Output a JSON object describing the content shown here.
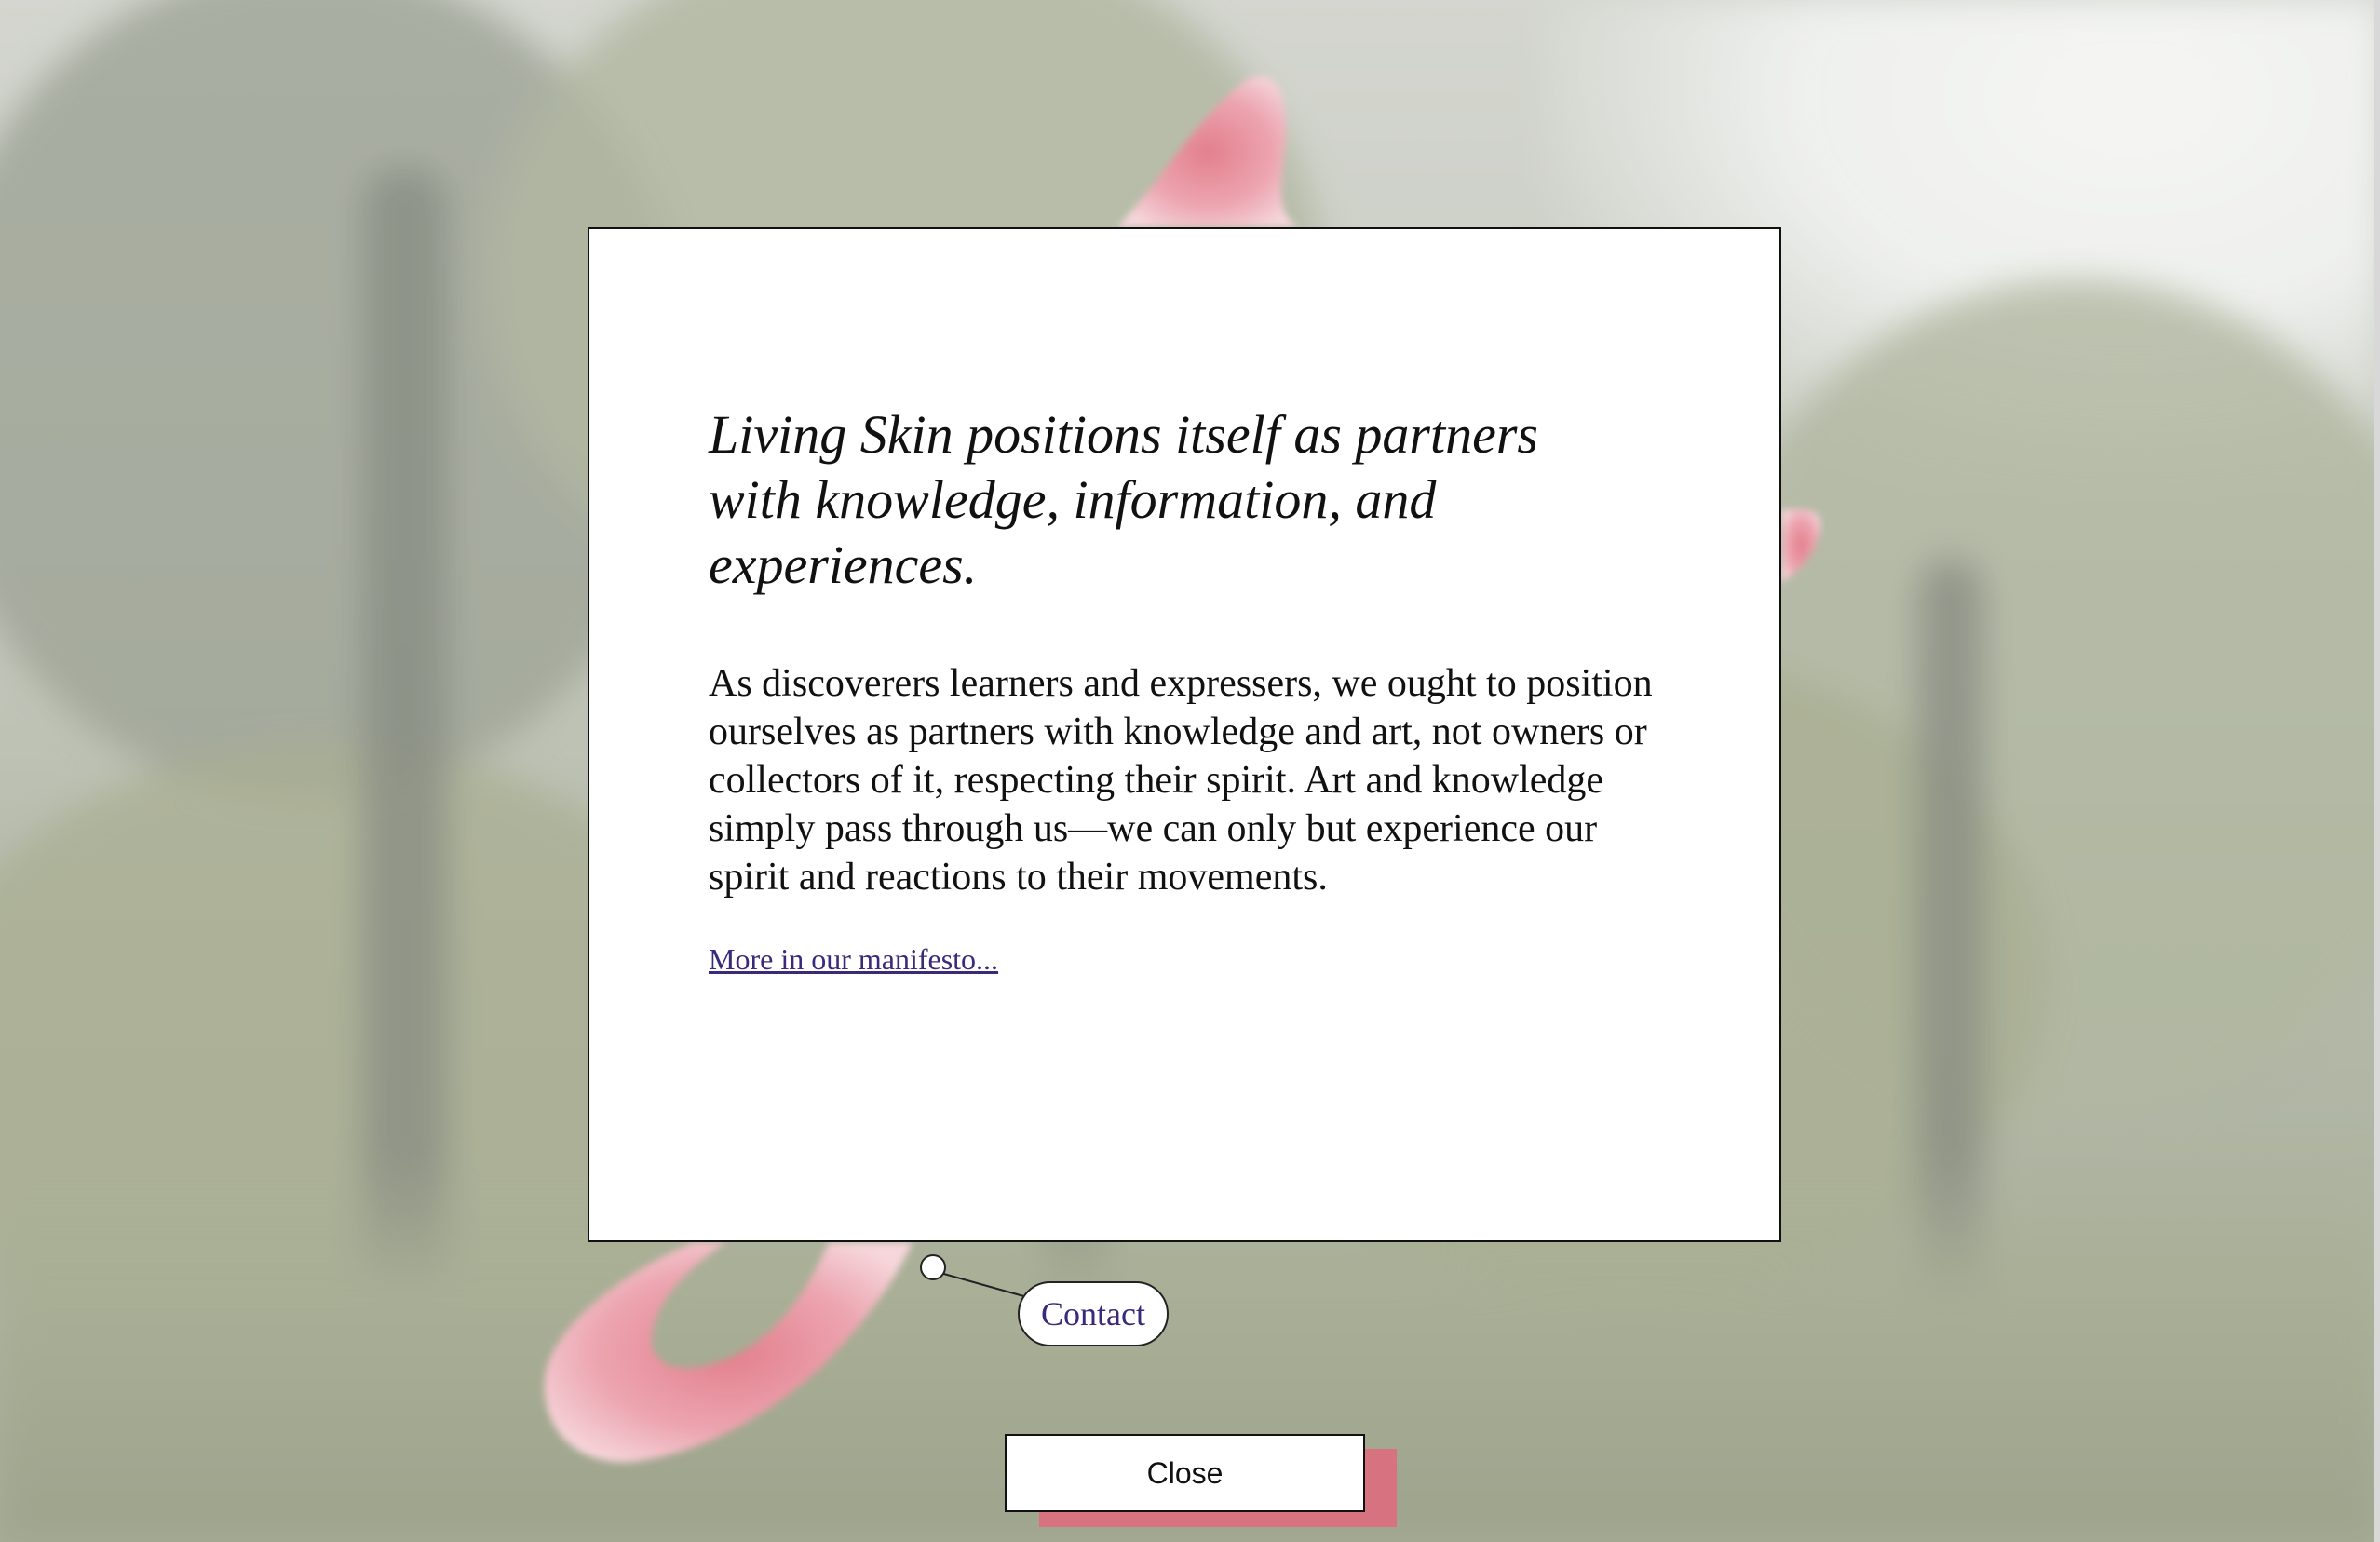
{
  "modal": {
    "heading": "Living Skin positions itself as partners with knowledge, information, and experiences.",
    "body": "As discoverers learners and expressers, we ought to position ourselves as partners with knowledge and art, not owners or collectors of it, respecting their spirit. Art and knowledge simply pass through us—we can only but experience our spirit and reactions to their movements.",
    "link_label": "More in our manifesto..."
  },
  "contact": {
    "label": "Contact"
  },
  "close": {
    "label": "Close"
  },
  "colors": {
    "accent_pink": "#e8a1ad",
    "link_purple": "#3a2a7a",
    "modal_bg": "#ffffff"
  }
}
